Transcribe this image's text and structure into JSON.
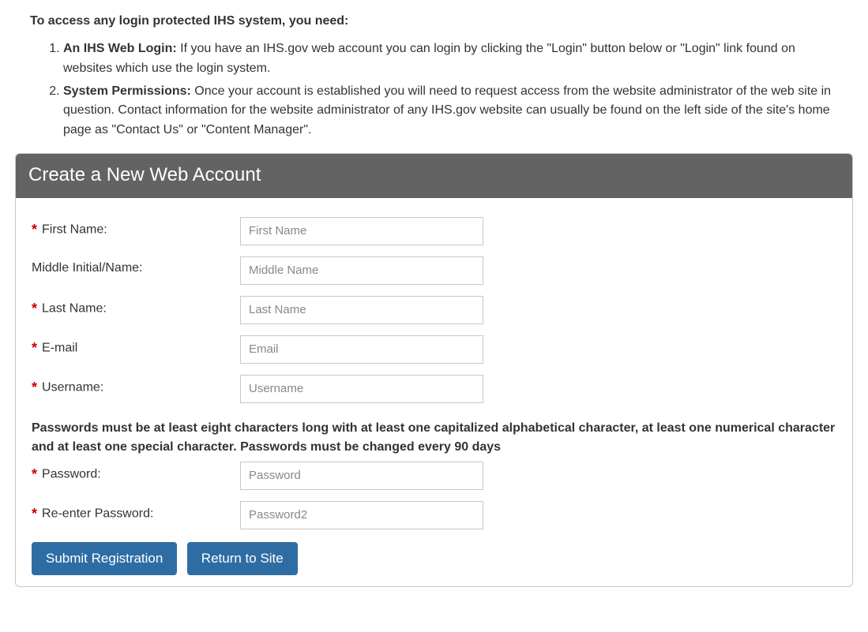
{
  "intro": {
    "heading": "To access any login protected IHS system, you need:",
    "items": [
      {
        "bold": "An IHS Web Login:",
        "text": " If you have an IHS.gov web account you can login by clicking the \"Login\" button below or \"Login\" link found on websites which use the login system."
      },
      {
        "bold": "System Permissions:",
        "text": " Once your account is established you will need to request access from the website administrator of the web site in question. Contact information for the website administrator of any IHS.gov website can usually be found on the left side of the site's home page as \"Contact Us\" or \"Content Manager\"."
      }
    ]
  },
  "panel": {
    "title": "Create a New Web Account",
    "fields": {
      "first_name": {
        "label": "First Name:",
        "placeholder": "First Name",
        "required": true
      },
      "middle_name": {
        "label": "Middle Initial/Name:",
        "placeholder": "Middle Name",
        "required": false
      },
      "last_name": {
        "label": "Last Name:",
        "placeholder": "Last Name",
        "required": true
      },
      "email": {
        "label": "E-mail",
        "placeholder": "Email",
        "required": true
      },
      "username": {
        "label": "Username:",
        "placeholder": "Username",
        "required": true
      },
      "password": {
        "label": "Password:",
        "placeholder": "Password",
        "required": true
      },
      "password2": {
        "label": "Re-enter Password:",
        "placeholder": "Password2",
        "required": true
      }
    },
    "password_note": "Passwords must be at least eight characters long with at least one capitalized alphabetical character, at least one numerical character and at least one special character. Passwords must be changed every 90 days",
    "buttons": {
      "submit": "Submit Registration",
      "return": "Return to Site"
    },
    "required_marker": "*"
  }
}
